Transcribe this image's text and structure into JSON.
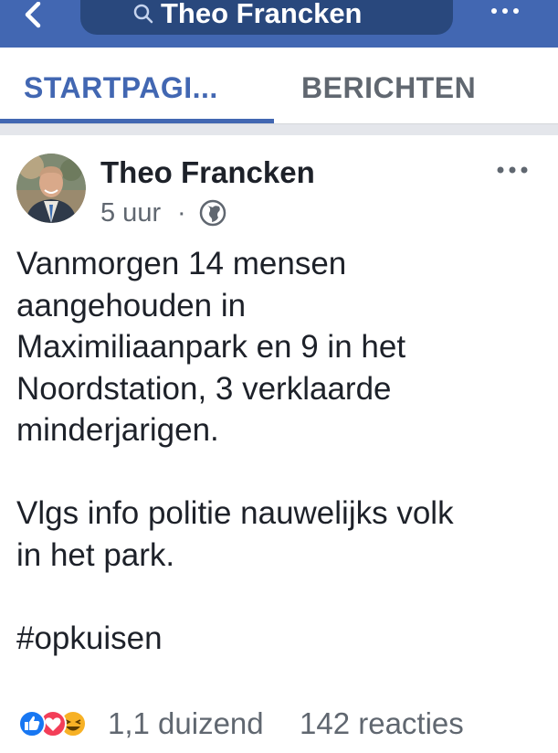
{
  "top_bar": {
    "search_text": "Theo Francken"
  },
  "tabs": [
    {
      "label": "STARTPAGI..."
    },
    {
      "label": "BERICHTEN"
    }
  ],
  "post": {
    "author": "Theo Francken",
    "time": "5 uur",
    "separator": "·",
    "paragraphs": [
      [
        "Vanmorgen 14 mensen",
        "aangehouden in",
        "Maximiliaanpark en 9 in het",
        "Noordstation, 3 verklaarde",
        "minderjarigen."
      ],
      [
        "Vlgs info politie nauwelijks volk",
        "in het park."
      ],
      [
        "#opkuisen"
      ]
    ],
    "reaction_count": "1,1 duizend",
    "comment_count": "142 reacties"
  },
  "icons": {
    "back": "chevron-left-icon",
    "search": "search-icon",
    "more": "more-horizontal-icon",
    "privacy": "globe-icon",
    "reactions": [
      "like-icon",
      "love-icon",
      "haha-icon"
    ]
  },
  "colors": {
    "brand_bar": "#4267b2",
    "search_pill": "#29487d",
    "active_tab": "#4267b2",
    "secondary_text": "#606770",
    "primary_text": "#1d2129",
    "like": "#1877f2",
    "love": "#f33e58",
    "haha": "#f7b125"
  }
}
